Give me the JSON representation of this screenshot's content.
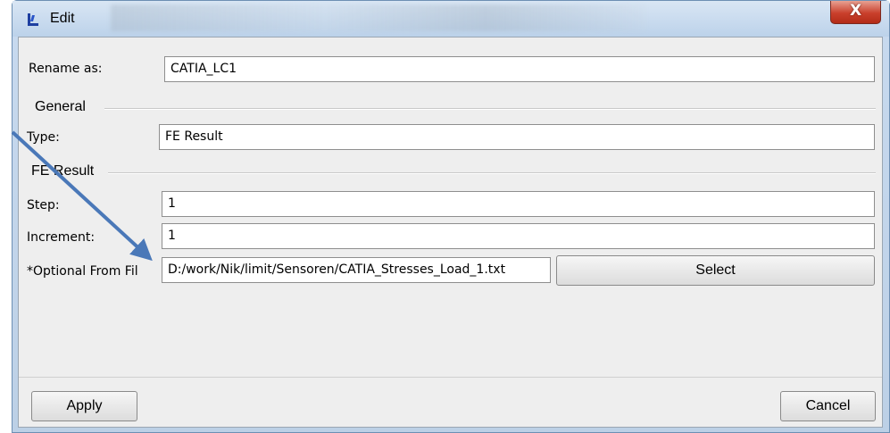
{
  "window": {
    "title": "Edit",
    "close_glyph": "X",
    "app_icon": "app-logo-icon"
  },
  "rename": {
    "label": "Rename as:",
    "value": "CATIA_LC1"
  },
  "general": {
    "heading": "General",
    "type_label": "Type:",
    "type_value": "FE Result"
  },
  "fe_result": {
    "heading": "FE Result",
    "step_label": "Step:",
    "step_value": "1",
    "increment_label": "Increment:",
    "increment_value": "1",
    "file_label": "*Optional From Fil",
    "file_value": "D:/work/Nik/limit/Sensoren/CATIA_Stresses_Load_1.txt",
    "select_label": "Select"
  },
  "footer": {
    "apply_label": "Apply",
    "cancel_label": "Cancel"
  },
  "colors": {
    "annotation_arrow": "#4a78b8",
    "close_button": "#c9402c"
  }
}
